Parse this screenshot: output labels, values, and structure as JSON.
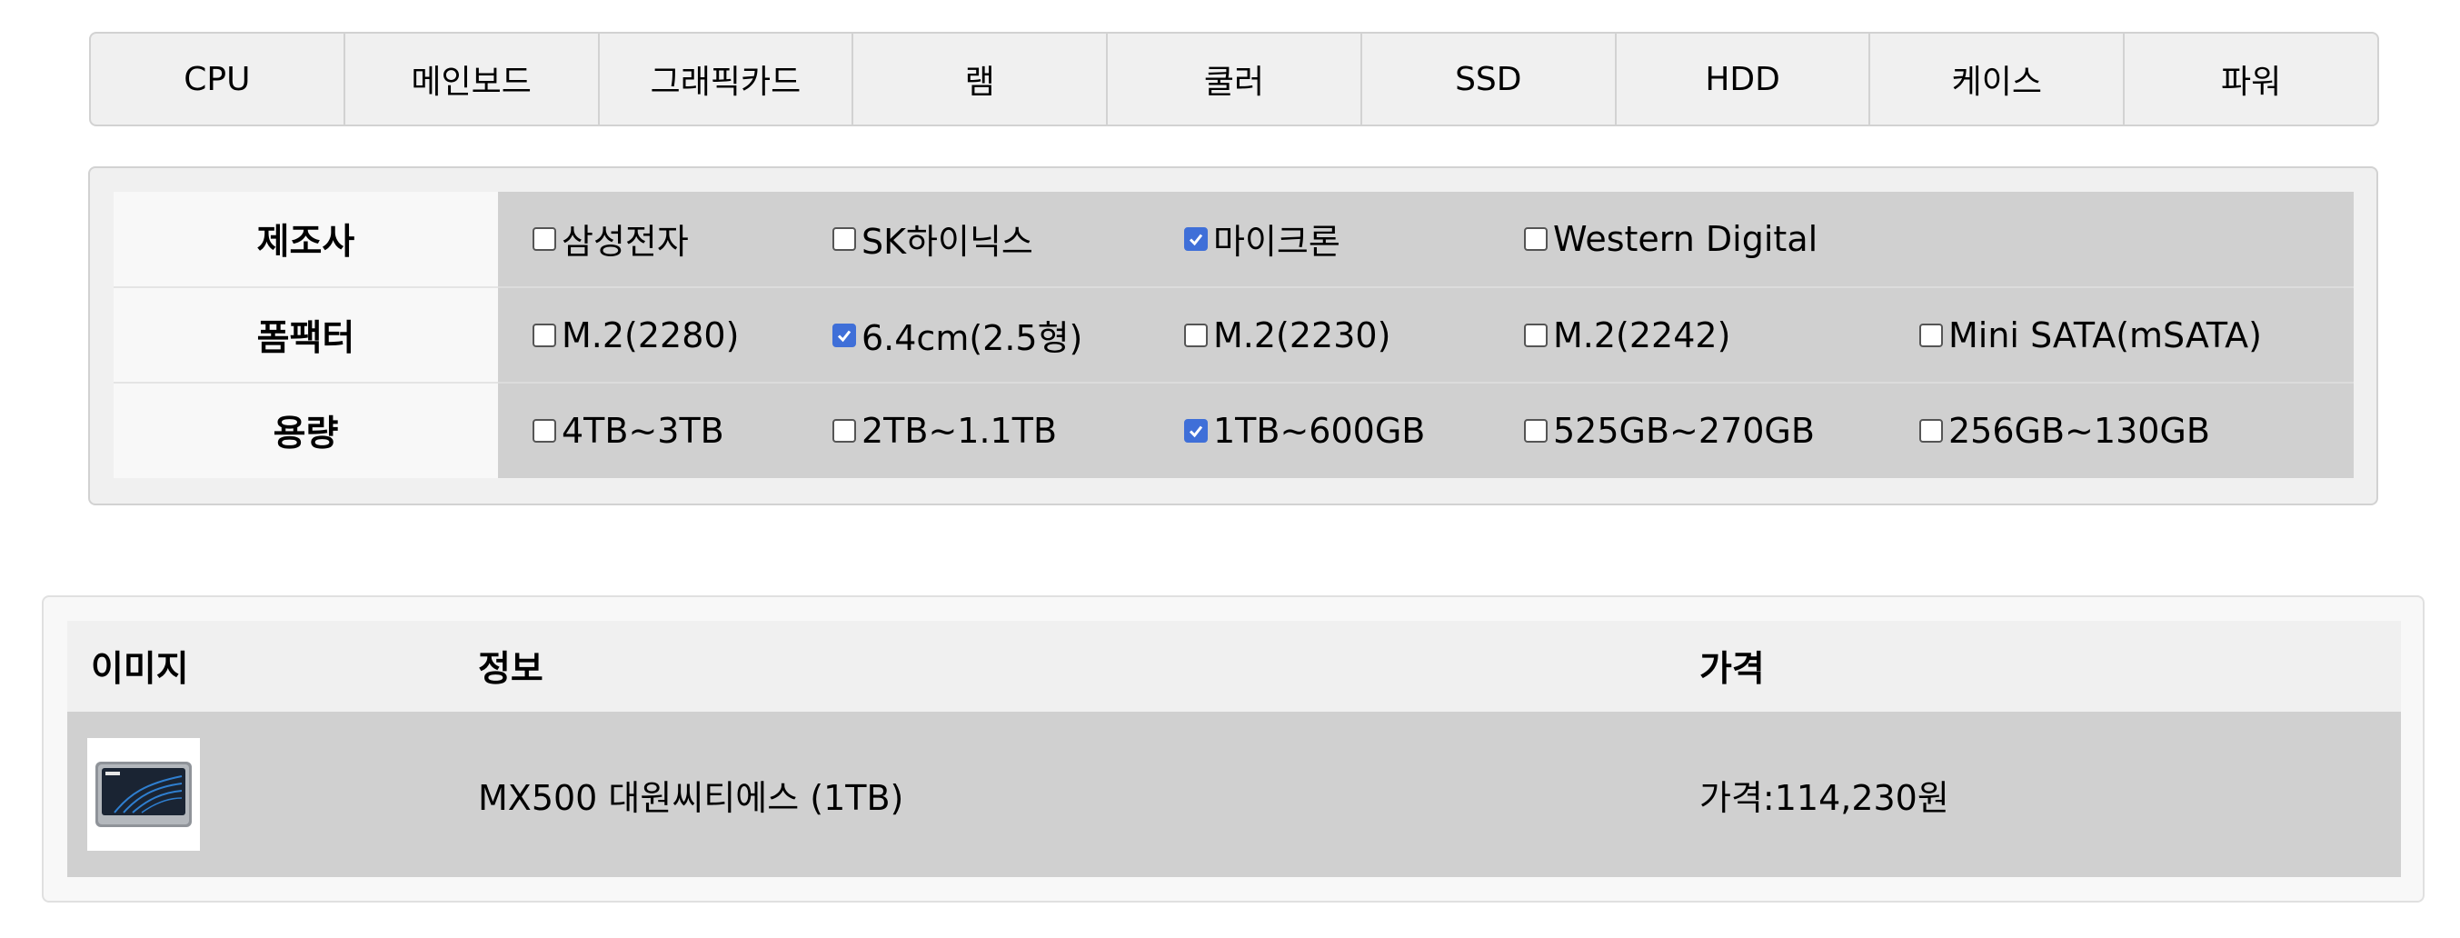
{
  "tabs": [
    "CPU",
    "메인보드",
    "그래픽카드",
    "램",
    "쿨러",
    "SSD",
    "HDD",
    "케이스",
    "파워"
  ],
  "filters": {
    "manufacturer": {
      "label": "제조사",
      "options": [
        {
          "label": "삼성전자",
          "checked": false
        },
        {
          "label": "SK하이닉스",
          "checked": false
        },
        {
          "label": "마이크론",
          "checked": true
        },
        {
          "label": "Western Digital",
          "checked": false
        }
      ]
    },
    "form_factor": {
      "label": "폼팩터",
      "options": [
        {
          "label": "M.2(2280)",
          "checked": false
        },
        {
          "label": "6.4cm(2.5형)",
          "checked": true
        },
        {
          "label": "M.2(2230)",
          "checked": false
        },
        {
          "label": "M.2(2242)",
          "checked": false
        },
        {
          "label": "Mini SATA(mSATA)",
          "checked": false
        }
      ]
    },
    "capacity": {
      "label": "용량",
      "options": [
        {
          "label": "4TB~3TB",
          "checked": false
        },
        {
          "label": "2TB~1.1TB",
          "checked": false
        },
        {
          "label": "1TB~600GB",
          "checked": true
        },
        {
          "label": "525GB~270GB",
          "checked": false
        },
        {
          "label": "256GB~130GB",
          "checked": false
        }
      ]
    }
  },
  "results": {
    "headers": {
      "image": "이미지",
      "info": "정보",
      "price": "가격"
    },
    "rows": [
      {
        "image_icon": "ssd-product-icon",
        "info": "MX500 대원씨티에스 (1TB)",
        "price": "가격:114,230원"
      }
    ]
  },
  "colors": {
    "checkbox_checked": "#3f6fd8",
    "cell_bg": "#d0d0d0",
    "panel_bg": "#f0f0f0"
  }
}
